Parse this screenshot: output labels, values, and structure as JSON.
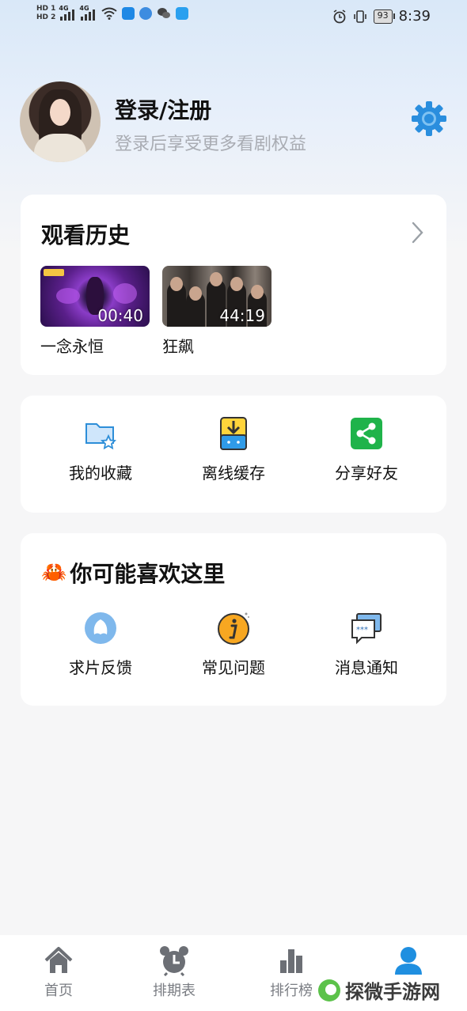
{
  "status_bar": {
    "hd1": "HD 1",
    "hd2": "HD 2",
    "net1": "4G",
    "net2": "4G",
    "battery": "93",
    "time": "8:39"
  },
  "profile": {
    "title": "登录/注册",
    "subtitle": "登录后享受更多看剧权益"
  },
  "history": {
    "title": "观看历史",
    "items": [
      {
        "title": "一念永恒",
        "duration": "00:40"
      },
      {
        "title": "狂飙",
        "duration": "44:19"
      }
    ]
  },
  "actions": {
    "items": [
      {
        "label": "我的收藏",
        "icon": "favorites-folder-icon"
      },
      {
        "label": "离线缓存",
        "icon": "download-icon"
      },
      {
        "label": "分享好友",
        "icon": "share-icon"
      }
    ]
  },
  "like": {
    "emoji": "🦀",
    "title": "你可能喜欢这里",
    "items": [
      {
        "label": "求片反馈",
        "icon": "feedback-icon"
      },
      {
        "label": "常见问题",
        "icon": "info-icon"
      },
      {
        "label": "消息通知",
        "icon": "message-icon"
      }
    ]
  },
  "bottom_nav": {
    "items": [
      {
        "label": "首页",
        "icon": "home-icon"
      },
      {
        "label": "排期表",
        "icon": "alarm-clock-icon"
      },
      {
        "label": "排行榜",
        "icon": "bar-chart-icon"
      },
      {
        "label": "",
        "icon": "user-icon",
        "active": true
      }
    ]
  },
  "watermark": "探微手游网",
  "colors": {
    "accent": "#1f8fe0",
    "nav_inactive": "#6c6f75"
  }
}
